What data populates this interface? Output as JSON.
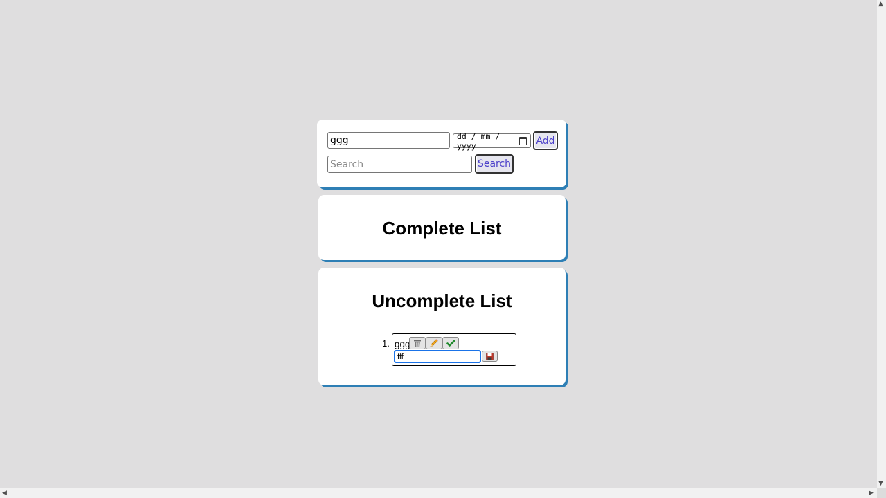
{
  "form": {
    "task_value": "ggg",
    "date_placeholder": "dd / mm / yyyy",
    "add_label": "Add",
    "search_placeholder": "Search",
    "search_label": "Search"
  },
  "complete_list": {
    "title": "Complete List",
    "items": []
  },
  "uncomplete_list": {
    "title": "Uncomplete List",
    "items": [
      {
        "number": "1.",
        "text": "ggg",
        "actions": [
          "trash-icon",
          "pencil-icon",
          "check-icon"
        ],
        "edit_value": "fff",
        "save_icon": "floppy-icon"
      }
    ]
  },
  "colors": {
    "background": "#dfdedf",
    "card_shadow": "#2e7fb5",
    "button_text": "#4a3fc9",
    "focus_border": "#1a73e8"
  },
  "scrollbars": {
    "up": "▲",
    "down": "▼",
    "left": "◀",
    "right": "▶"
  }
}
